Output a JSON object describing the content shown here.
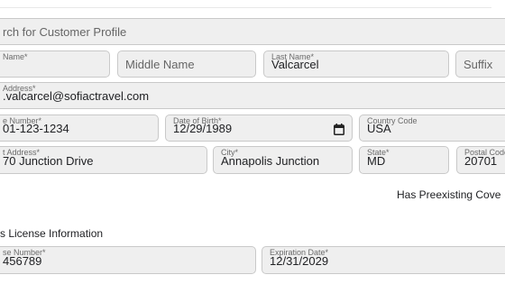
{
  "search": {
    "placeholder": "rch for Customer Profile"
  },
  "first_name": {
    "label": "Name",
    "value": ""
  },
  "middle_name": {
    "placeholder": "Middle Name"
  },
  "last_name": {
    "label": "Last Name",
    "value": "Valcarcel"
  },
  "suffix": {
    "placeholder": "Suffix"
  },
  "email": {
    "label": "Address",
    "value": ".valcarcel@sofiactravel.com"
  },
  "phone": {
    "label": "e Number",
    "value": "01-123-1234"
  },
  "dob": {
    "label": "Date of Birth",
    "value": "12/29/1989"
  },
  "country": {
    "label": "Country Code",
    "value": "USA"
  },
  "street": {
    "label": "t Address",
    "value": "70 Junction Drive"
  },
  "city": {
    "label": "City",
    "value": "Annapolis Junction"
  },
  "state": {
    "label": "State",
    "value": "MD"
  },
  "postal": {
    "label": "Postal Code",
    "value": "20701"
  },
  "coverage": {
    "label": "Has Preexisting Cove"
  },
  "license_section": {
    "title": "s License Information"
  },
  "license_number": {
    "label": "se Number",
    "value": "456789"
  },
  "expiration": {
    "label": "Expiration Date",
    "value": "12/31/2029"
  },
  "required_mark": "*",
  "icons": {
    "calendar": "calendar-icon"
  }
}
